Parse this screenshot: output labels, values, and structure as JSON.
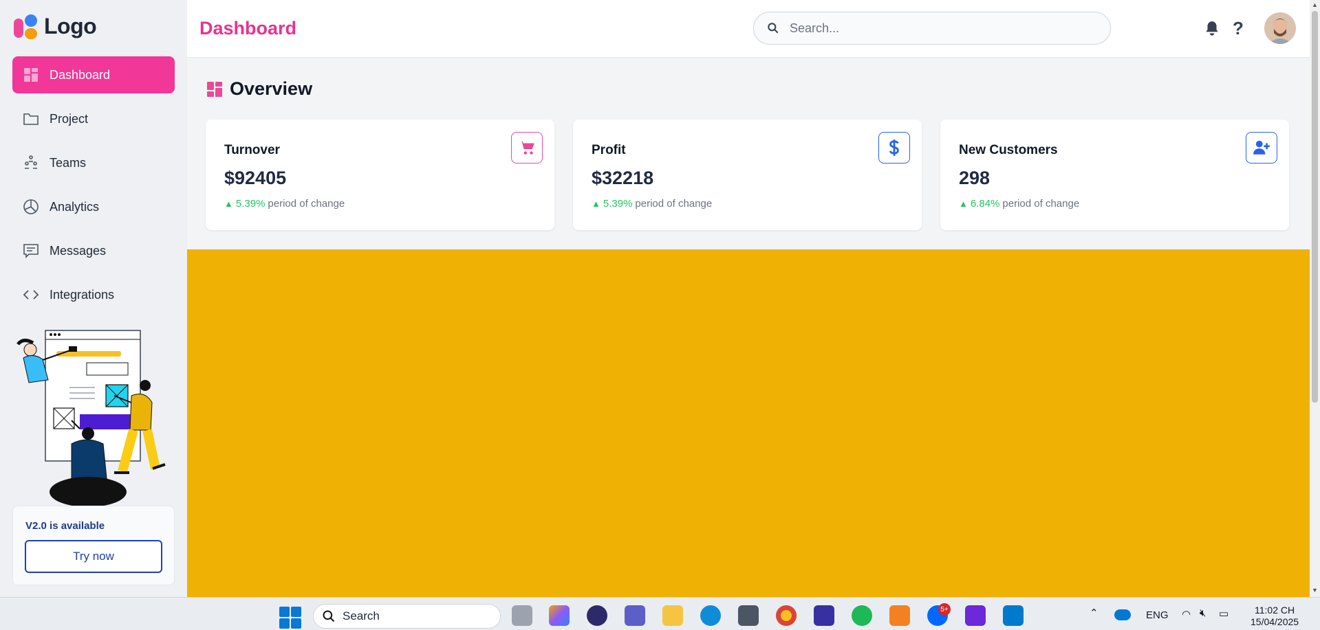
{
  "sidebar": {
    "logo_text": "Logo",
    "items": [
      {
        "label": "Dashboard",
        "icon": "grid-icon",
        "active": true
      },
      {
        "label": "Project",
        "icon": "folder-icon"
      },
      {
        "label": "Teams",
        "icon": "teams-icon"
      },
      {
        "label": "Analytics",
        "icon": "pie-chart-icon"
      },
      {
        "label": "Messages",
        "icon": "message-icon"
      },
      {
        "label": "Integrations",
        "icon": "code-icon"
      }
    ],
    "update": {
      "title": "V2.0 is available",
      "button": "Try now"
    }
  },
  "header": {
    "title": "Dashboard",
    "search_placeholder": "Search..."
  },
  "overview": {
    "title": "Overview",
    "cards": [
      {
        "label": "Turnover",
        "value": "$92405",
        "change": "5.39%",
        "change_text": "period of change",
        "icon": "cart-icon",
        "accent": "#ec4899"
      },
      {
        "label": "Profit",
        "value": "$32218",
        "change": "5.39%",
        "change_text": "period of change",
        "icon": "dollar-icon",
        "accent": "#2563eb"
      },
      {
        "label": "New Customers",
        "value": "298",
        "change": "6.84%",
        "change_text": "period of change",
        "icon": "add-user-icon",
        "accent": "#2563eb"
      }
    ]
  },
  "colors": {
    "primary": "#f13797",
    "panel": "#efb104",
    "positive": "#22c55e"
  },
  "taskbar": {
    "search_label": "Search",
    "badge": "5+",
    "language": "ENG",
    "time": "11:02 CH",
    "date": "15/04/2025"
  }
}
